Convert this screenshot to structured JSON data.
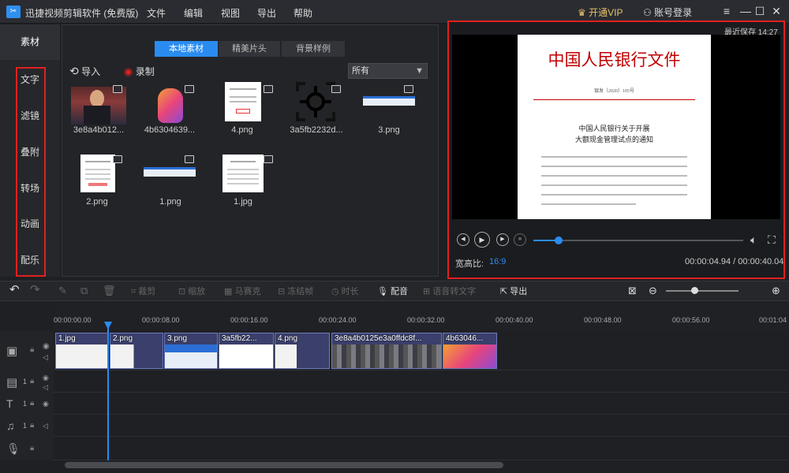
{
  "app": {
    "title": "迅捷视频剪辑软件 (免费版)",
    "logo": "✂"
  },
  "menu": [
    "文件",
    "编辑",
    "视图",
    "导出",
    "帮助"
  ],
  "header": {
    "vip": "开通VIP",
    "account": "账号登录",
    "vip_icon": "crown-icon",
    "account_icon": "user-icon"
  },
  "window_controls": {
    "menu": "≡",
    "minimize": "—",
    "maximize": "☐",
    "close": "✕"
  },
  "left_tabs": {
    "material": "素材",
    "items": [
      "文字",
      "滤镜",
      "叠附",
      "转场",
      "动画",
      "配乐"
    ]
  },
  "media": {
    "tabs": [
      "本地素材",
      "精美片头",
      "背景样例"
    ],
    "import_label": "导入",
    "record_label": "录制",
    "filter_value": "所有",
    "items": [
      {
        "name": "3e8a4b012...",
        "kind": "video"
      },
      {
        "name": "4b6304639...",
        "kind": "image"
      },
      {
        "name": "4.png",
        "kind": "image"
      },
      {
        "name": "3a5fb2232d...",
        "kind": "image"
      },
      {
        "name": "3.png",
        "kind": "image"
      },
      {
        "name": "2.png",
        "kind": "image"
      },
      {
        "name": "1.png",
        "kind": "image"
      },
      {
        "name": "1.jpg",
        "kind": "image"
      }
    ]
  },
  "preview": {
    "save_label": "最近保存 14:27",
    "doc": {
      "title": "中国人民银行文件",
      "number": "银发〔2020〕105号",
      "sub1": "中国人民银行关于开展",
      "sub2": "大额现金管理试点的通知"
    },
    "progress": 0.12,
    "aspect_label": "宽高比:",
    "aspect_value": "16:9",
    "timecode": "00:00:04.94 / 00:00:40.04"
  },
  "toolbar": {
    "undo": "↶",
    "redo": "↷",
    "split": "",
    "delete": "",
    "crop": "裁剪",
    "zoom": "缩放",
    "mosaic": "马赛克",
    "freeze": "冻结帧",
    "duration": "时长",
    "dub": "配音",
    "tts": "语音转文字",
    "export": "导出"
  },
  "timeline": {
    "ticks": [
      "00:00:00.00",
      "00:00:08.00",
      "00:00:16.00",
      "00:00:24.00",
      "00:00:32.00",
      "00:00:40.00",
      "00:00:48.00",
      "00:00:56.00",
      "00:01:04"
    ],
    "clips": [
      "1.jpg",
      "2.png",
      "3.png",
      "3a5fb22...",
      "4.png",
      "3e8a4b0125e3a0ffdc8f...",
      "4b63046..."
    ],
    "track_nums": [
      "1",
      "1",
      "1"
    ]
  }
}
